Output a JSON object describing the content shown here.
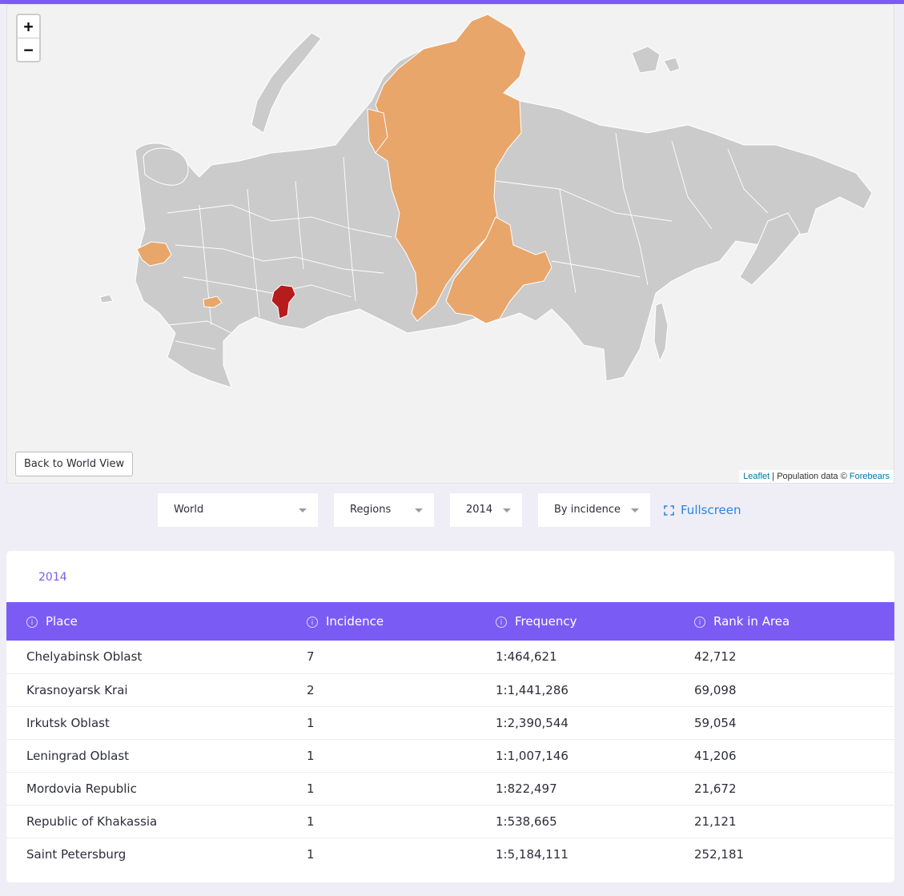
{
  "map": {
    "zoom_in_label": "+",
    "zoom_out_label": "−",
    "back_button_label": "Back to World View",
    "attribution": {
      "leaflet": "Leaflet",
      "separator": " | Population data © ",
      "forebears": "Forebears"
    },
    "colors": {
      "land": "#cbcbcb",
      "border": "#ffffff",
      "low": "#e8a66b",
      "high": "#b71c1c"
    }
  },
  "controls": {
    "scope": "World",
    "level": "Regions",
    "year": "2014",
    "mode": "By incidence",
    "fullscreen_label": "Fullscreen"
  },
  "table": {
    "year_tab": "2014",
    "headers": [
      "Place",
      "Incidence",
      "Frequency",
      "Rank in Area"
    ],
    "rows": [
      {
        "place": "Chelyabinsk Oblast",
        "incidence": "7",
        "frequency": "1:464,621",
        "rank": "42,712"
      },
      {
        "place": "Krasnoyarsk Krai",
        "incidence": "2",
        "frequency": "1:1,441,286",
        "rank": "69,098"
      },
      {
        "place": "Irkutsk Oblast",
        "incidence": "1",
        "frequency": "1:2,390,544",
        "rank": "59,054"
      },
      {
        "place": "Leningrad Oblast",
        "incidence": "1",
        "frequency": "1:1,007,146",
        "rank": "41,206"
      },
      {
        "place": "Mordovia Republic",
        "incidence": "1",
        "frequency": "1:822,497",
        "rank": "21,672"
      },
      {
        "place": "Republic of Khakassia",
        "incidence": "1",
        "frequency": "1:538,665",
        "rank": "21,121"
      },
      {
        "place": "Saint Petersburg",
        "incidence": "1",
        "frequency": "1:5,184,111",
        "rank": "252,181"
      }
    ]
  }
}
